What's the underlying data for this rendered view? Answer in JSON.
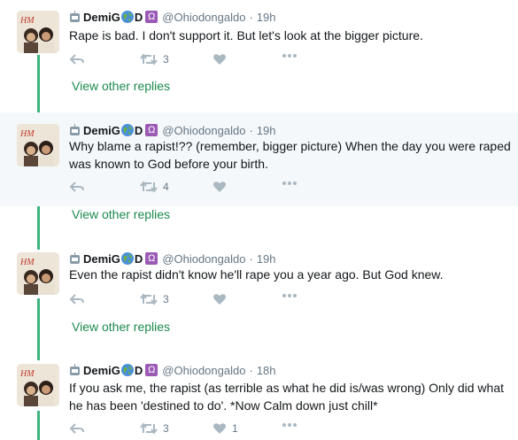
{
  "tweets": [
    {
      "name": "DemiG",
      "name_suffix": "D",
      "handle": "@Ohiodongaldo",
      "time": "19h",
      "text": "Rape is bad. I don't support it. But let's look at the bigger picture.",
      "retweets": "3",
      "likes": ""
    },
    {
      "name": "DemiG",
      "name_suffix": "D",
      "handle": "@Ohiodongaldo",
      "time": "19h",
      "text": "Why blame a rapist!?? (remember, bigger picture) When the day you were raped was known to God before your birth.",
      "retweets": "4",
      "likes": ""
    },
    {
      "name": "DemiG",
      "name_suffix": "D",
      "handle": "@Ohiodongaldo",
      "time": "19h",
      "text": "Even the rapist didn't know he'll rape you a year ago. But God knew.",
      "retweets": "3",
      "likes": ""
    },
    {
      "name": "DemiG",
      "name_suffix": "D",
      "handle": "@Ohiodongaldo",
      "time": "18h",
      "text": "If you ask me, the rapist (as terrible as what he did is/was wrong) Only did what he has been 'destined to do'.  *Now Calm down just chill*",
      "retweets": "3",
      "likes": "1"
    }
  ],
  "view_other_replies": "View other replies",
  "badges": {
    "omega": "Ω"
  },
  "colors": {
    "thread_line": "#3fb37f",
    "link": "#1d8a4f",
    "highlight_bg": "#f5f8fa",
    "icon": "#aab8c2"
  },
  "icons": [
    "reply-icon",
    "retweet-icon",
    "like-icon",
    "more-icon",
    "globe-icon",
    "robot-icon"
  ]
}
